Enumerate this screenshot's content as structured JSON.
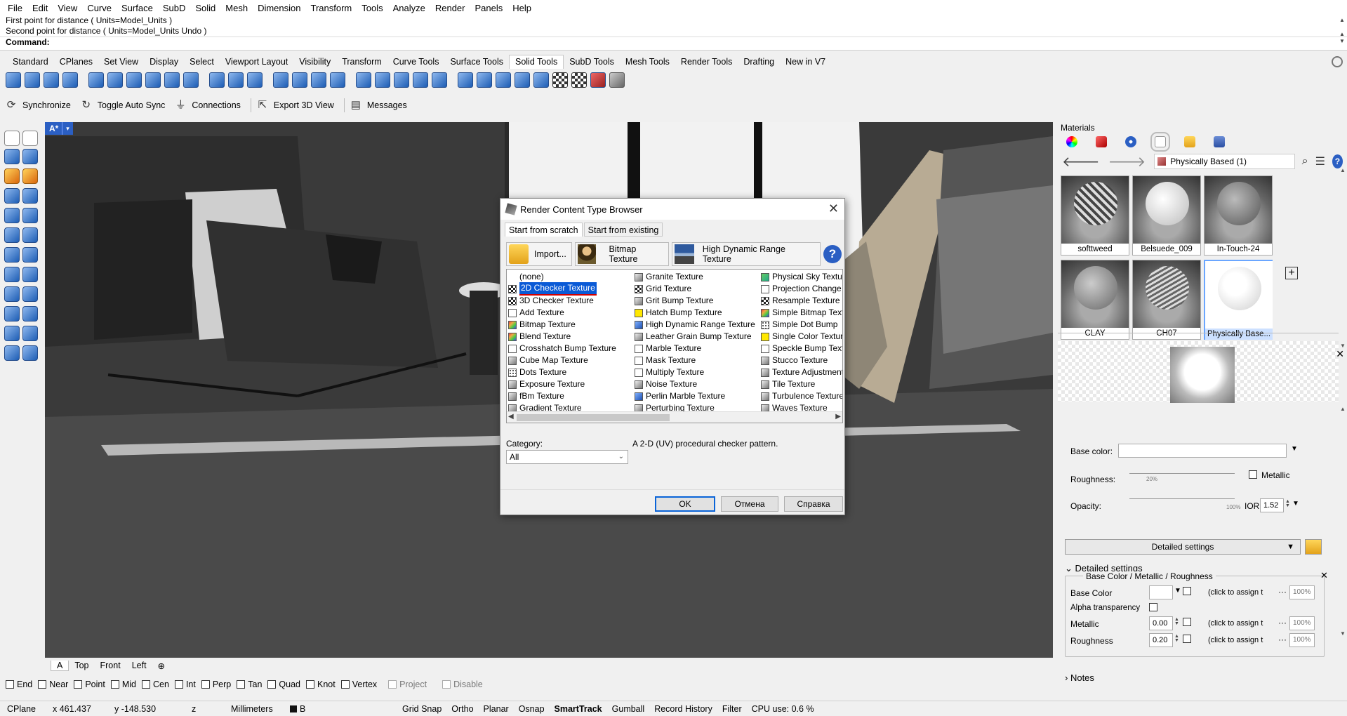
{
  "menu": [
    "File",
    "Edit",
    "View",
    "Curve",
    "Surface",
    "SubD",
    "Solid",
    "Mesh",
    "Dimension",
    "Transform",
    "Tools",
    "Analyze",
    "Render",
    "Panels",
    "Help"
  ],
  "command": {
    "history": [
      "First point for distance ( Units=Model_Units )",
      "Second point for distance ( Units=Model_Units  Undo )"
    ],
    "prompt": "Command:"
  },
  "toolbar_tabs": [
    "Standard",
    "CPlanes",
    "Set View",
    "Display",
    "Select",
    "Viewport Layout",
    "Visibility",
    "Transform",
    "Curve Tools",
    "Surface Tools",
    "Solid Tools",
    "SubD Tools",
    "Mesh Tools",
    "Render Tools",
    "Drafting",
    "New in V7"
  ],
  "active_toolbar_tab": "Solid Tools",
  "sync_toolbar": {
    "synchronize": "Synchronize",
    "toggle_auto_sync": "Toggle Auto Sync",
    "connections": "Connections",
    "export_3d_view": "Export 3D View",
    "messages": "Messages"
  },
  "viewport": {
    "label": "A*",
    "menu_arrow": "▾",
    "tabs": [
      "A",
      "Top",
      "Front",
      "Left"
    ],
    "add_tab": "⊕"
  },
  "osnaps": [
    "End",
    "Near",
    "Point",
    "Mid",
    "Cen",
    "Int",
    "Perp",
    "Tan",
    "Quad",
    "Knot",
    "Vertex"
  ],
  "osnap_disabled": [
    "Project",
    "Disable"
  ],
  "status": {
    "cplane": "CPlane",
    "x": "x 461.437",
    "y": "y -148.530",
    "z": "z",
    "units": "Millimeters",
    "layer": "B",
    "grid_snap": "Grid Snap",
    "ortho": "Ortho",
    "planar": "Planar",
    "osnap": "Osnap",
    "smarttrack": "SmartTrack",
    "gumball": "Gumball",
    "record_history": "Record History",
    "filter": "Filter",
    "cpu": "CPU use: 0.6 %"
  },
  "dialog": {
    "title": "Render Content Type Browser",
    "close": "✕",
    "tabs": [
      "Start from scratch",
      "Start from existing"
    ],
    "quick": {
      "import": "Import...",
      "bitmap": "Bitmap Texture",
      "hdr": "High Dynamic Range Texture",
      "help": "?"
    },
    "col1": [
      {
        "label": "(none)",
        "icon": ""
      },
      {
        "label": "2D Checker Texture",
        "icon": "i-chk"
      },
      {
        "label": "3D Checker Texture",
        "icon": "i-chk"
      },
      {
        "label": "Add Texture",
        "icon": "i-wht"
      },
      {
        "label": "Bitmap Texture",
        "icon": "i-col"
      },
      {
        "label": "Blend Texture",
        "icon": "i-col"
      },
      {
        "label": "Crosshatch Bump Texture",
        "icon": "i-wht"
      },
      {
        "label": "Cube Map Texture",
        "icon": "i-gry"
      },
      {
        "label": "Dots Texture",
        "icon": "i-dot"
      },
      {
        "label": "Exposure Texture",
        "icon": "i-gry"
      },
      {
        "label": "fBm Texture",
        "icon": "i-gry"
      },
      {
        "label": "Gradient Texture",
        "icon": "i-gry"
      }
    ],
    "col2": [
      {
        "label": "Granite Texture",
        "icon": "i-gry"
      },
      {
        "label": "Grid Texture",
        "icon": "i-chk"
      },
      {
        "label": "Grit Bump Texture",
        "icon": "i-gry"
      },
      {
        "label": "Hatch Bump Texture",
        "icon": "i-yel"
      },
      {
        "label": "High Dynamic Range Texture",
        "icon": "i-blu"
      },
      {
        "label": "Leather Grain Bump Texture",
        "icon": "i-gry"
      },
      {
        "label": "Marble Texture",
        "icon": "i-wht"
      },
      {
        "label": "Mask Texture",
        "icon": "i-wht"
      },
      {
        "label": "Multiply Texture",
        "icon": "i-wht"
      },
      {
        "label": "Noise Texture",
        "icon": "i-gry"
      },
      {
        "label": "Perlin Marble Texture",
        "icon": "i-blu"
      },
      {
        "label": "Perturbing Texture",
        "icon": "i-gry"
      }
    ],
    "col3": [
      {
        "label": "Physical Sky Texture",
        "icon": "i-grn"
      },
      {
        "label": "Projection Change",
        "icon": "i-wht"
      },
      {
        "label": "Resample Texture",
        "icon": "i-chk"
      },
      {
        "label": "Simple Bitmap Texture",
        "icon": "i-col"
      },
      {
        "label": "Simple Dot Bump",
        "icon": "i-dot"
      },
      {
        "label": "Single Color Texture",
        "icon": "i-yel"
      },
      {
        "label": "Speckle Bump Texture",
        "icon": "i-wht"
      },
      {
        "label": "Stucco Texture",
        "icon": "i-gry"
      },
      {
        "label": "Texture Adjustment",
        "icon": "i-gry"
      },
      {
        "label": "Tile Texture",
        "icon": "i-gry"
      },
      {
        "label": "Turbulence Texture",
        "icon": "i-gry"
      },
      {
        "label": "Waves Texture",
        "icon": "i-gry"
      }
    ],
    "selected": "2D Checker Texture",
    "category_label": "Category:",
    "category_value": "All",
    "description": "A 2-D (UV) procedural checker pattern.",
    "ok": "OK",
    "cancel": "Отмена",
    "help": "Справка"
  },
  "materials": {
    "title": "Materials",
    "breadcrumb": "Physically Based (1)",
    "items": [
      "softtweed",
      "Belsuede_009",
      "In-Touch-24",
      "CLAY",
      "CH07",
      "Physically Base..."
    ],
    "selected": "Physically Base...",
    "add": "+",
    "props": {
      "base_color": "Base color:",
      "roughness": "Roughness:",
      "roughness_tick": "20%",
      "metallic": "Metallic",
      "opacity": "Opacity:",
      "opacity_tick": "100%",
      "ior_label": "IOR:",
      "ior_value": "1.52",
      "detailed_btn": "Detailed settings",
      "detailed_header": "Detailed settings",
      "box_title": "Base Color /  Metallic / Roughness",
      "rows": [
        {
          "label": "Base Color",
          "value": "",
          "assign": "(click to assign t",
          "pct": "100%"
        },
        {
          "label": "Alpha transparency",
          "value": "",
          "assign": "",
          "pct": ""
        },
        {
          "label": "Metallic",
          "value": "0.00",
          "assign": "(click to assign t",
          "pct": "100%"
        },
        {
          "label": "Roughness",
          "value": "0.20",
          "assign": "(click to assign t",
          "pct": "100%"
        }
      ],
      "notes": "Notes"
    }
  },
  "colors": {
    "accent": "#2b5fc3",
    "selection": "#0a5ad6",
    "underline": "#d20000",
    "viewport_bg": "#3d3d3d"
  }
}
